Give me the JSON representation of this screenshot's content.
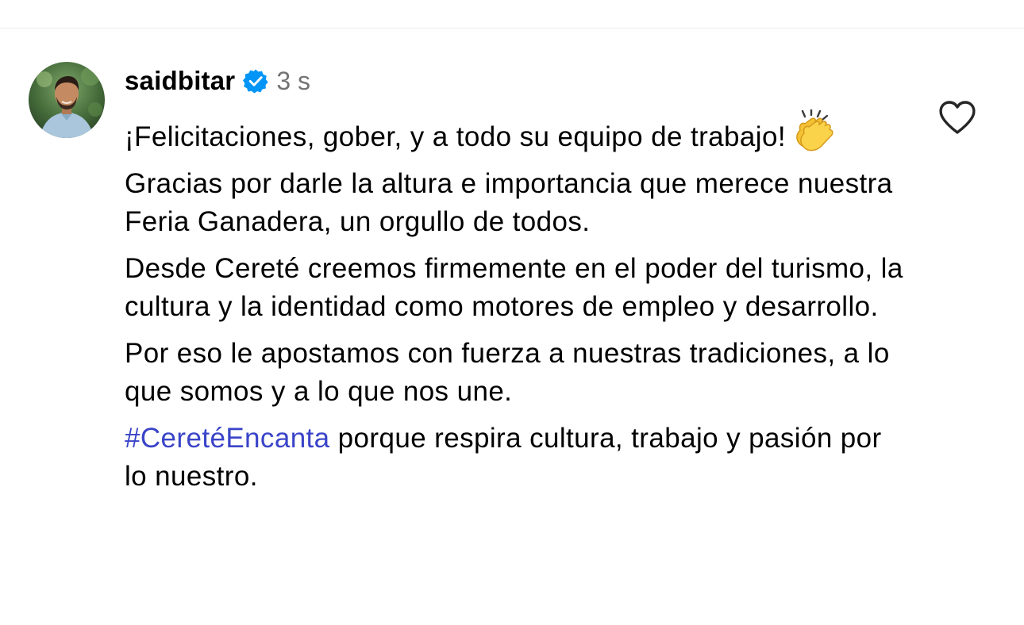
{
  "comment": {
    "avatar_icon": "user-avatar-photo",
    "username": "saidbitar",
    "verified_icon": "verified-badge-icon",
    "timestamp": "3 s",
    "like_icon": "heart-outline-icon",
    "paragraphs": {
      "p1": {
        "text": "¡Felicitaciones, gober, y a todo su equipo de trabajo!",
        "emoji_icon": "clapping-hands-icon"
      },
      "p2": "Gracias por darle la altura e importancia que merece nuestra Feria Ganadera, un orgullo de todos.",
      "p3": "Desde Cereté creemos firmemente en el poder del turismo, la cultura y la identidad como motores de empleo y desarrollo.",
      "p4": "Por eso le apostamos con fuerza a nuestras tradiciones, a lo que somos y a lo que nos une.",
      "p5": {
        "hashtag": "#CeretéEncanta",
        "text": " porque respira cultura, trabajo y pasión por lo nuestro."
      }
    },
    "colors": {
      "hashtag": "#3a44c8",
      "verified_badge": "#0095f6",
      "timestamp": "#737373",
      "divider": "#ececec"
    }
  }
}
